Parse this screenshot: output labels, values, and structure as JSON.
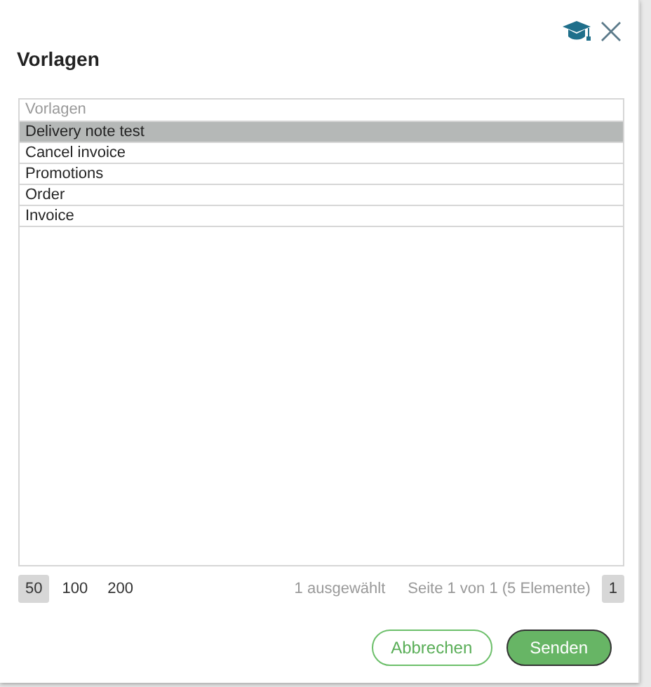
{
  "dialog": {
    "title": "Vorlagen"
  },
  "grid": {
    "column": "Vorlagen",
    "rows": [
      {
        "label": "Delivery note test",
        "selected": true
      },
      {
        "label": "Cancel invoice",
        "selected": false
      },
      {
        "label": "Promotions",
        "selected": false
      },
      {
        "label": "Order",
        "selected": false
      },
      {
        "label": "Invoice",
        "selected": false
      }
    ]
  },
  "pager": {
    "sizes": [
      {
        "label": "50",
        "selected": true
      },
      {
        "label": "100",
        "selected": false
      },
      {
        "label": "200",
        "selected": false
      }
    ],
    "selection": "1 ausgewählt",
    "info": "Seite 1 von 1 (5 Elemente)",
    "pages": [
      {
        "label": "1",
        "selected": true
      }
    ]
  },
  "buttons": [
    {
      "label": "Abbrechen",
      "kind": "secondary"
    },
    {
      "label": "Senden",
      "kind": "primary"
    }
  ]
}
